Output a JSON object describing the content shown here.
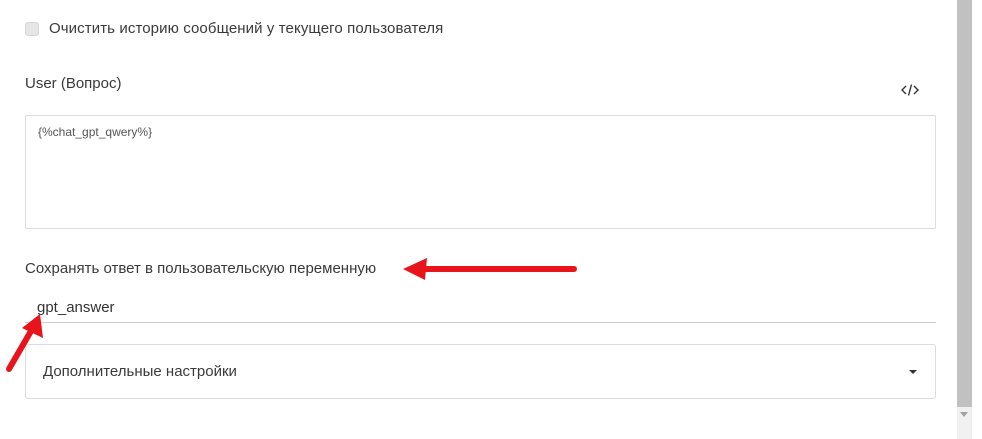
{
  "options": {
    "clear_history_label": "Очистить историю сообщений у текущего пользователя",
    "clear_history_checked": false
  },
  "user_question": {
    "label": "User (Вопрос)",
    "code_toggle_icon": "code-icon",
    "value": "{%chat_gpt_qwery%}"
  },
  "save_answer": {
    "label": "Сохранять ответ в пользовательскую переменную",
    "value": "gpt_answer"
  },
  "advanced_settings": {
    "label": "Дополнительные настройки",
    "icon": "caret-down-icon"
  },
  "annotations": {
    "arrow_color": "#e8141b"
  }
}
